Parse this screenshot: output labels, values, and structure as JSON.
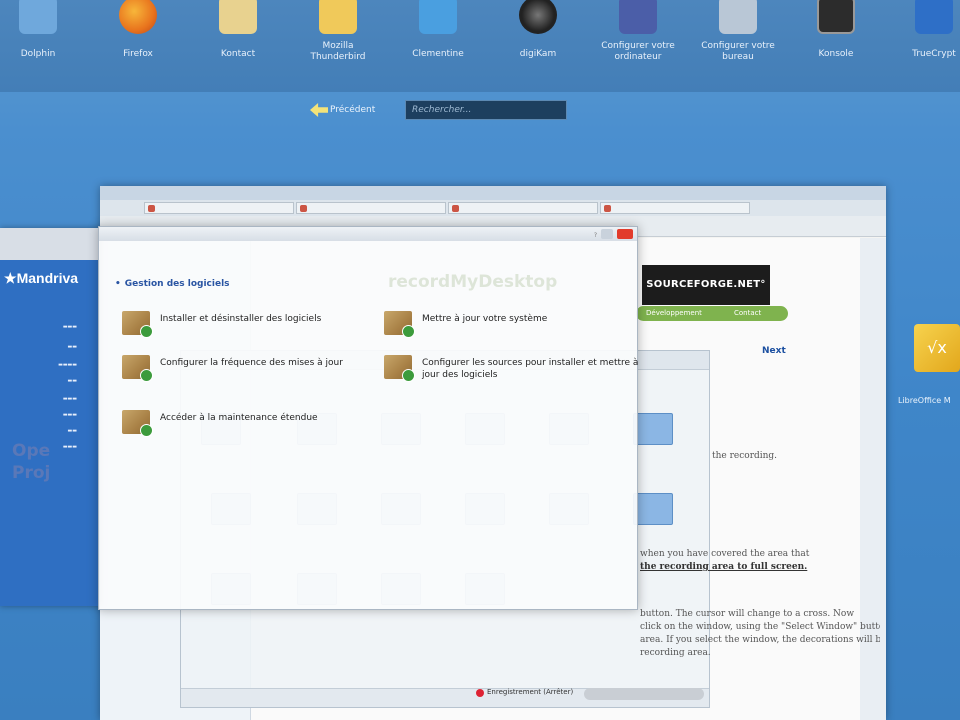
{
  "launcher": {
    "apps": [
      {
        "label": "Dolphin",
        "icon": "folder-icon",
        "color": "#6fa8dc"
      },
      {
        "label": "Firefox",
        "icon": "firefox-icon",
        "color": "#e8731d"
      },
      {
        "label": "Kontact",
        "icon": "contact-icon",
        "color": "#e8d28f"
      },
      {
        "label": "Mozilla\nThunderbird",
        "icon": "mail-icon",
        "color": "#f0c95a"
      },
      {
        "label": "Clementine",
        "icon": "media-player-icon",
        "color": "#4a9fe0"
      },
      {
        "label": "digiKam",
        "icon": "camera-lens-icon",
        "color": "#2b2b2b"
      },
      {
        "label": "Configurer votre\nordinateur",
        "icon": "control-center-icon",
        "color": "#4b5ea8"
      },
      {
        "label": "Configurer votre\nbureau",
        "icon": "desktop-settings-icon",
        "color": "#b9c7d6"
      },
      {
        "label": "Konsole",
        "icon": "terminal-icon",
        "color": "#2c2c2c"
      },
      {
        "label": "TrueCrypt",
        "icon": "key-icon",
        "color": "#2e6fc7"
      }
    ],
    "previous": "Précédent",
    "search_placeholder": "Rechercher..."
  },
  "browser": {
    "sourceforge_logo": "SOURCEFORGE.NET°",
    "nav_left": "Développement",
    "nav_right": "Contact",
    "next_link": "Next",
    "text_1": "the recording.",
    "text_2": "when you have covered the area that",
    "text_3": "the recording area to full screen.",
    "text_4": "button. The cursor will change to a cross. Now",
    "text_5": "click on the window, using the \"Select Window\" button will only set the",
    "text_6": "area. If you select the window, the decorations will be included in the",
    "text_7": "recording area.",
    "stop_label": "Enregistrement (Arrêter)"
  },
  "software_dialog": {
    "section_title": "Gestion des logiciels",
    "options": [
      "Installer et désinstaller des logiciels",
      "Mettre à jour votre système",
      "Configurer la fréquence des mises à jour",
      "Configurer les sources pour installer et mettre à jour des logiciels",
      "Accéder à la maintenance étendue"
    ],
    "watermark": "recordMyDesktop"
  },
  "control_center": {
    "brand": "Mandriva",
    "projects": "Ope\nProj"
  },
  "desktop_icon": {
    "label": "LibreOffice M"
  }
}
